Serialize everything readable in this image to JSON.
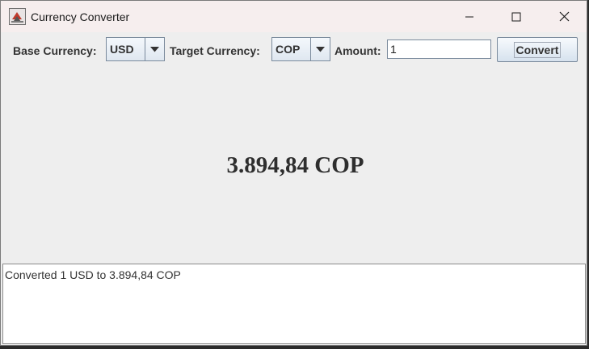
{
  "window": {
    "title": "Currency Converter",
    "app_icon": "java-cup-icon"
  },
  "titlebar_buttons": [
    "minimize-icon",
    "maximize-icon",
    "close-icon"
  ],
  "form": {
    "base_label": "Base Currency:",
    "base_value": "USD",
    "target_label": "Target Currency:",
    "target_value": "COP",
    "amount_label": "Amount:",
    "amount_value": "1",
    "convert_label": "Convert"
  },
  "result": {
    "text": "3.894,84 COP"
  },
  "log": {
    "lines": [
      "Converted 1 USD to 3.894,84 COP"
    ]
  },
  "colors": {
    "titlebar": "#f6eeee",
    "panel": "#eeeeee",
    "control_border": "#7a8a9c"
  }
}
